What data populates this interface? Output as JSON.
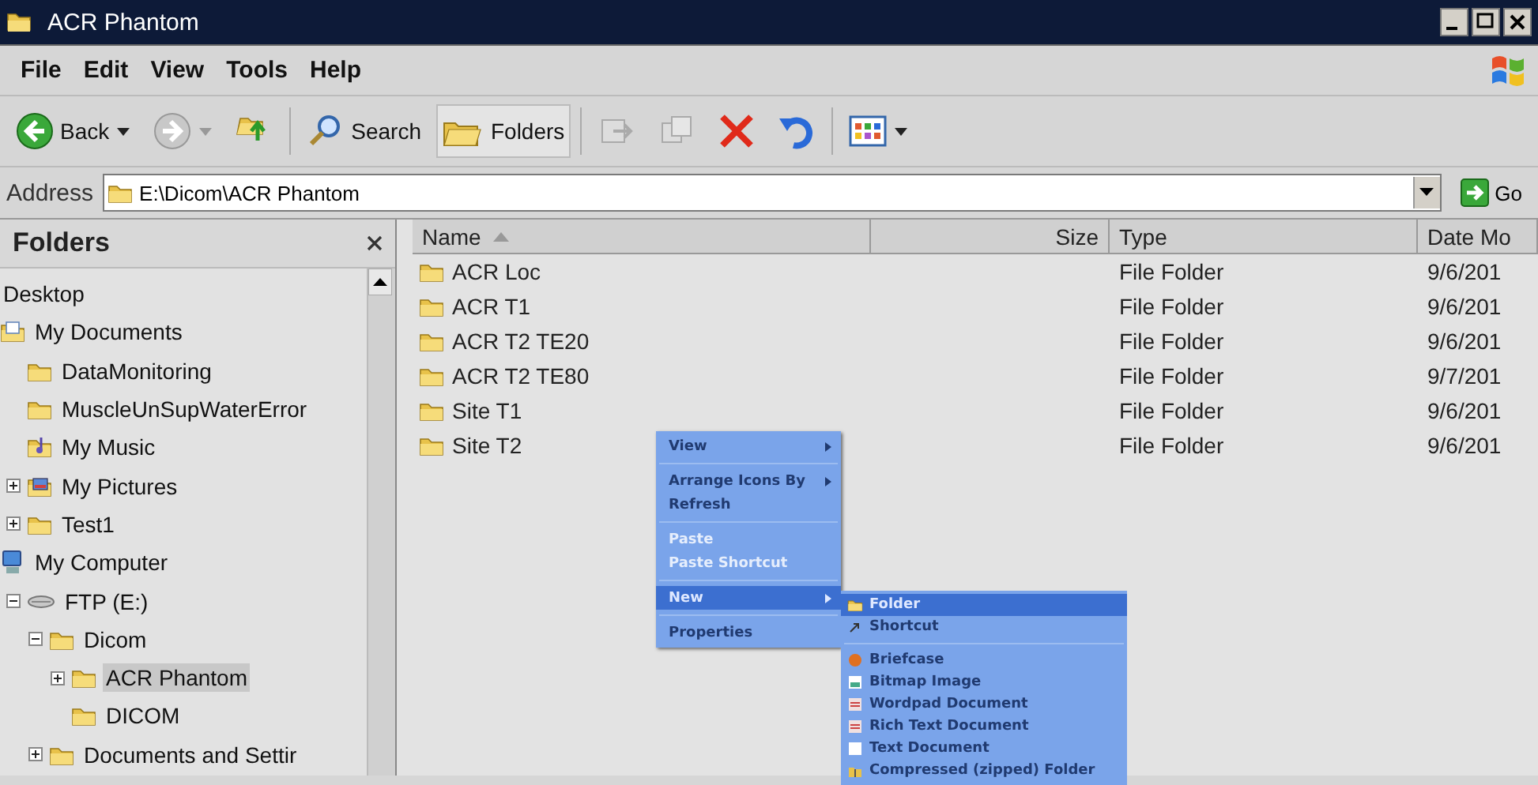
{
  "window": {
    "title": "ACR Phantom"
  },
  "menu_bar": [
    "File",
    "Edit",
    "View",
    "Tools",
    "Help"
  ],
  "toolbar": [
    {
      "kind": "back",
      "label": "Back",
      "pressed": false
    },
    {
      "kind": "forward",
      "pressed": false
    },
    {
      "kind": "up",
      "pressed": false
    },
    {
      "kind": "search",
      "label": "Search",
      "pressed": false
    },
    {
      "kind": "folders",
      "label": "Folders",
      "pressed": true
    },
    {
      "kind": "move",
      "pressed": false
    },
    {
      "kind": "copy",
      "pressed": false
    },
    {
      "kind": "delete",
      "pressed": false
    },
    {
      "kind": "undo",
      "pressed": false
    },
    {
      "kind": "views",
      "pressed": false
    }
  ],
  "address": {
    "label": "Address",
    "value": "E:\\Dicom\\ACR Phantom",
    "go": "Go"
  },
  "folders_pane": {
    "title": "Folders",
    "tree": [
      {
        "label": "Desktop",
        "kind": "desktop",
        "selected": false
      },
      {
        "label": "My Documents",
        "kind": "documents",
        "selected": false,
        "children": [
          {
            "label": "DataMonitoring",
            "kind": "folder",
            "selected": false
          },
          {
            "label": "MuscleUnSupWaterError",
            "kind": "folder",
            "selected": false
          },
          {
            "label": "My Music",
            "kind": "music",
            "selected": false
          },
          {
            "label": "My Pictures",
            "kind": "pictures",
            "expanded": false,
            "selected": false
          },
          {
            "label": "Test1",
            "kind": "folder",
            "expanded": false,
            "selected": false
          }
        ]
      },
      {
        "label": "My Computer",
        "kind": "computer",
        "selected": false,
        "children": [
          {
            "label": "FTP (E:)",
            "kind": "drive",
            "expanded": true,
            "selected": false,
            "children": [
              {
                "label": "Dicom",
                "kind": "folder",
                "expanded": true,
                "selected": false,
                "children": [
                  {
                    "label": "ACR Phantom",
                    "kind": "folder",
                    "expanded": false,
                    "selected": true
                  },
                  {
                    "label": "DICOM",
                    "kind": "folder",
                    "selected": false
                  }
                ]
              },
              {
                "label": "Documents and Settir",
                "kind": "folder",
                "expanded": false,
                "selected": false
              }
            ]
          }
        ]
      }
    ]
  },
  "file_list": {
    "columns": [
      {
        "label": "Name",
        "sorted": true
      },
      {
        "label": "Size",
        "sorted": false
      },
      {
        "label": "Type",
        "sorted": false
      },
      {
        "label": "Date Mo",
        "sorted": false
      }
    ],
    "rows": [
      {
        "name": "ACR Loc",
        "type": "File Folder",
        "date": "9/6/201"
      },
      {
        "name": "ACR T1",
        "type": "File Folder",
        "date": "9/6/201"
      },
      {
        "name": "ACR T2 TE20",
        "type": "File Folder",
        "date": "9/6/201"
      },
      {
        "name": "ACR T2 TE80",
        "type": "File Folder",
        "date": "9/7/201"
      },
      {
        "name": "Site T1",
        "type": "File Folder",
        "date": "9/6/201"
      },
      {
        "name": "Site T2",
        "type": "File Folder",
        "date": "9/6/201"
      }
    ]
  },
  "context_menu": {
    "items": [
      {
        "kind": "item",
        "label": "View",
        "submenu": true,
        "disabled": false,
        "selected": false
      },
      {
        "kind": "separator"
      },
      {
        "kind": "item",
        "label": "Arrange Icons By",
        "submenu": true,
        "disabled": false,
        "selected": false
      },
      {
        "kind": "item",
        "label": "Refresh",
        "submenu": false,
        "disabled": false,
        "selected": false
      },
      {
        "kind": "separator"
      },
      {
        "kind": "item",
        "label": "Paste",
        "submenu": false,
        "disabled": true,
        "selected": false
      },
      {
        "kind": "item",
        "label": "Paste Shortcut",
        "submenu": false,
        "disabled": true,
        "selected": false
      },
      {
        "kind": "separator"
      },
      {
        "kind": "item",
        "label": "New",
        "submenu": true,
        "disabled": false,
        "selected": true
      },
      {
        "kind": "separator"
      },
      {
        "kind": "item",
        "label": "Properties",
        "submenu": false,
        "disabled": false,
        "selected": false
      }
    ],
    "submenu": [
      {
        "kind": "folder",
        "label": "Folder",
        "selected": true
      },
      {
        "kind": "shortcut",
        "label": "Shortcut",
        "selected": false
      },
      {
        "kind": "separator"
      },
      {
        "kind": "briefcase",
        "label": "Briefcase",
        "selected": false
      },
      {
        "kind": "bitmap",
        "label": "Bitmap Image",
        "selected": false
      },
      {
        "kind": "wordpad",
        "label": "Wordpad Document",
        "selected": false
      },
      {
        "kind": "rtf",
        "label": "Rich Text Document",
        "selected": false
      },
      {
        "kind": "text",
        "label": "Text Document",
        "selected": false
      },
      {
        "kind": "zip",
        "label": "Compressed (zipped) Folder",
        "selected": false
      }
    ]
  }
}
